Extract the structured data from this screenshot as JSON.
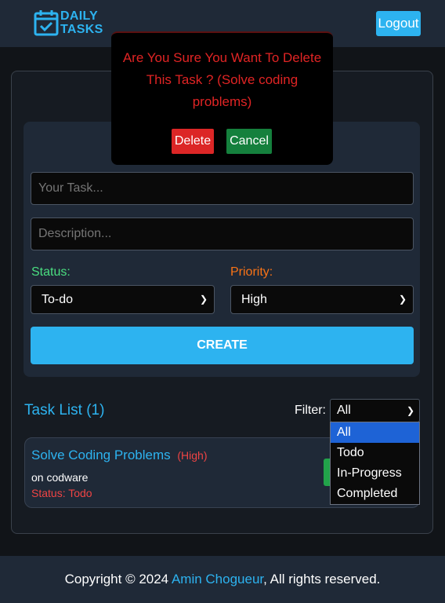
{
  "header": {
    "logo_line1": "DAILY",
    "logo_line2": "TASKS",
    "logout_label": "Logout"
  },
  "form": {
    "task_placeholder": "Your Task...",
    "description_placeholder": "Description...",
    "status_label": "Status:",
    "status_value": "To-do",
    "priority_label": "Priority:",
    "priority_value": "High",
    "create_label": "CREATE"
  },
  "task_list": {
    "title": "Task List (1)",
    "filter_label": "Filter:",
    "filter_value": "All",
    "filter_options": [
      "All",
      "Todo",
      "In-Progress",
      "Completed"
    ],
    "tasks": [
      {
        "title": "Solve Coding Problems",
        "priority": "(High)",
        "description": "on codware",
        "status": "Status: Todo"
      }
    ]
  },
  "modal": {
    "message": "Are You Sure You Want To Delete This Task ? (Solve coding problems)",
    "delete_label": "Delete",
    "cancel_label": "Cancel"
  },
  "footer": {
    "prefix": "Copyright © 2024 ",
    "author": "Amin Chogueur",
    "suffix": ", All rights reserved."
  },
  "colors": {
    "accent": "#2db3f0",
    "danger": "#dc2626",
    "success": "#15803d",
    "background": "#111418"
  }
}
